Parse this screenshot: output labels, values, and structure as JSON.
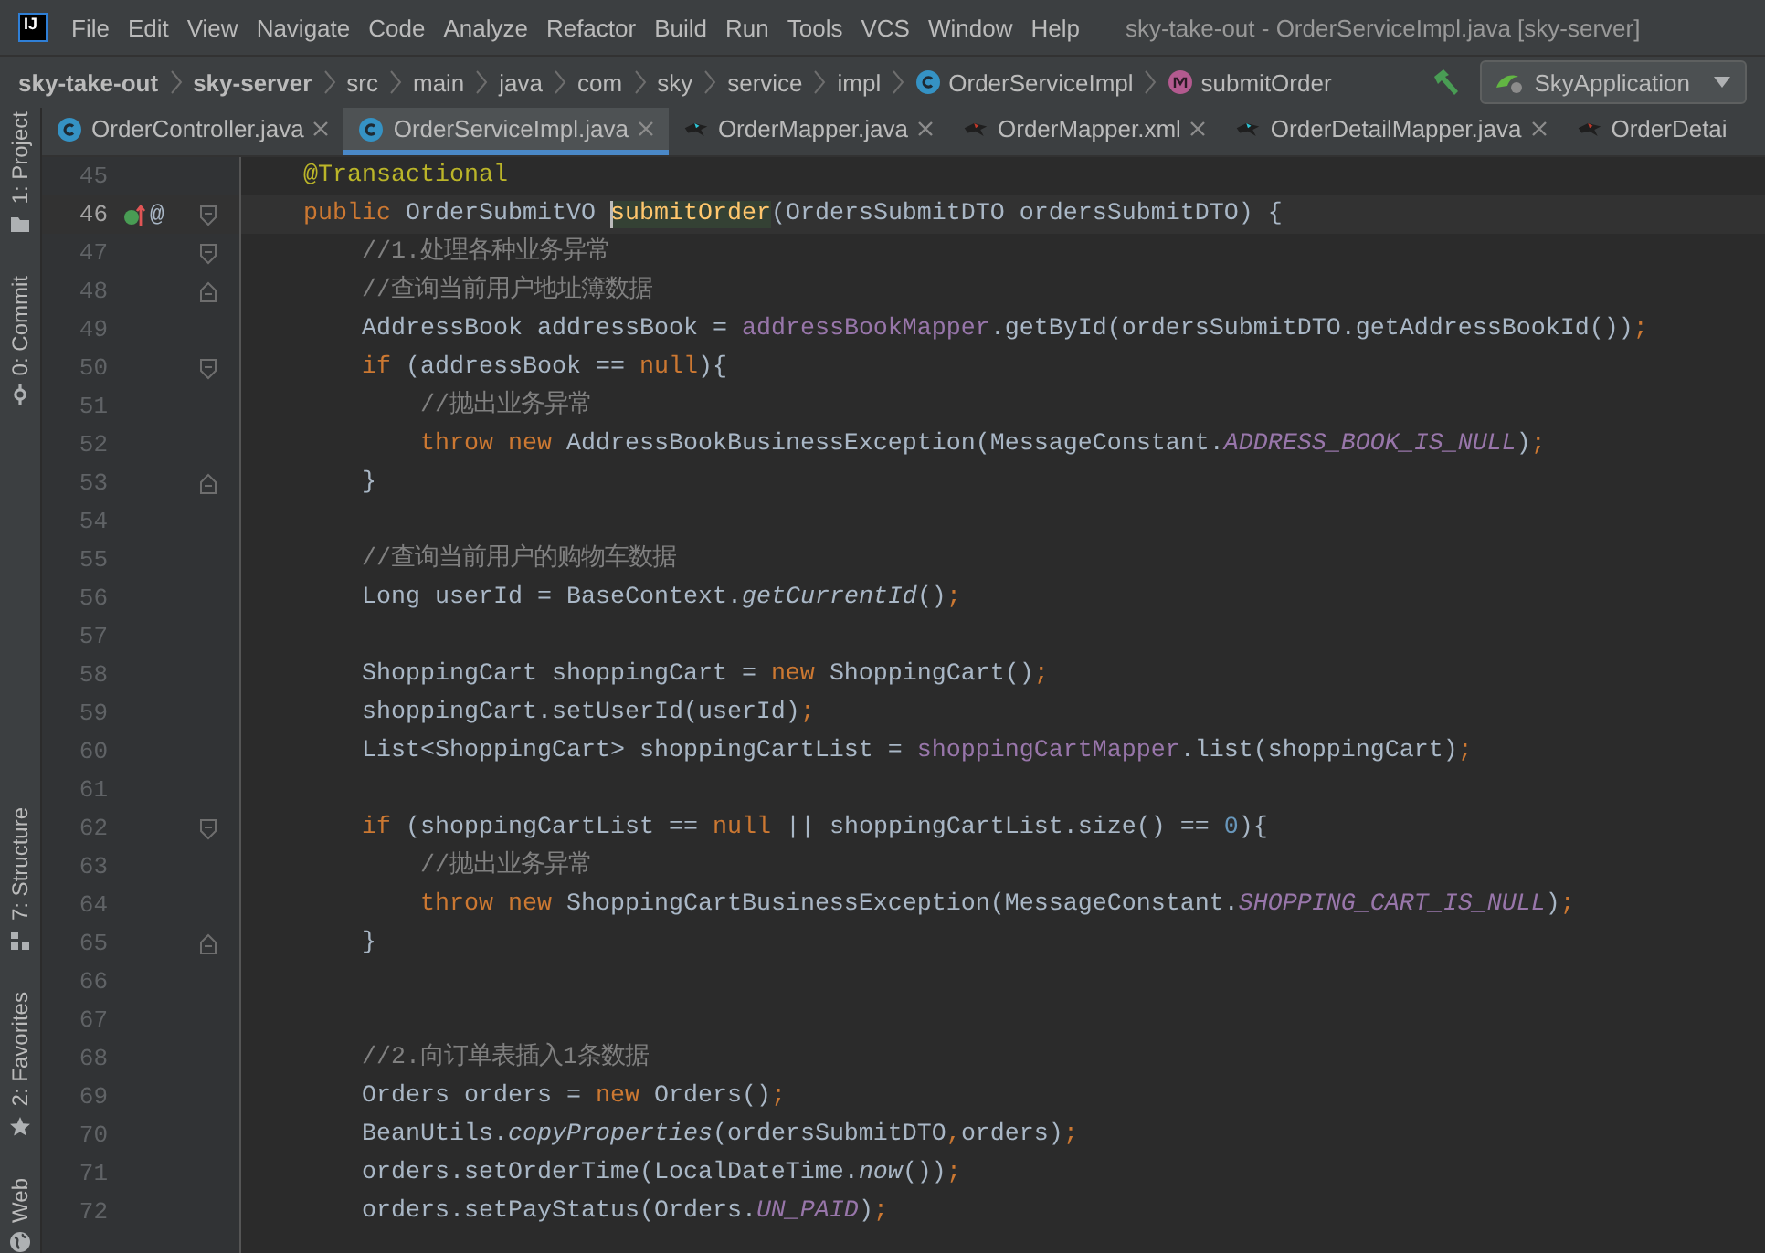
{
  "window": {
    "logo": "IJ",
    "title": "sky-take-out - OrderServiceImpl.java [sky-server]"
  },
  "menu": [
    "File",
    "Edit",
    "View",
    "Navigate",
    "Code",
    "Analyze",
    "Refactor",
    "Build",
    "Run",
    "Tools",
    "VCS",
    "Window",
    "Help"
  ],
  "breadcrumbs": [
    {
      "text": "sky-take-out",
      "kind": "module"
    },
    {
      "text": "sky-server",
      "kind": "module"
    },
    {
      "text": "src",
      "kind": "folder"
    },
    {
      "text": "main",
      "kind": "folder"
    },
    {
      "text": "java",
      "kind": "folder"
    },
    {
      "text": "com",
      "kind": "folder"
    },
    {
      "text": "sky",
      "kind": "folder"
    },
    {
      "text": "service",
      "kind": "folder"
    },
    {
      "text": "impl",
      "kind": "folder"
    },
    {
      "text": "OrderServiceImpl",
      "kind": "class"
    },
    {
      "text": "submitOrder",
      "kind": "method"
    }
  ],
  "run_config": {
    "name": "SkyApplication"
  },
  "tabs": [
    {
      "label": "OrderController.java",
      "kind": "class",
      "selected": false,
      "closable": true
    },
    {
      "label": "OrderServiceImpl.java",
      "kind": "class",
      "selected": true,
      "closable": true
    },
    {
      "label": "OrderMapper.java",
      "kind": "mapper",
      "selected": false,
      "closable": true
    },
    {
      "label": "OrderMapper.xml",
      "kind": "xml",
      "selected": false,
      "closable": true
    },
    {
      "label": "OrderDetailMapper.java",
      "kind": "mapper",
      "selected": false,
      "closable": true
    },
    {
      "label": "OrderDetai",
      "kind": "xml",
      "selected": false,
      "closable": false
    }
  ],
  "tool_windows": {
    "top": [
      {
        "label": "1: Project",
        "kind": "folder"
      },
      {
        "label": "0: Commit",
        "kind": "commit"
      }
    ],
    "bottom": [
      {
        "label": "7: Structure",
        "kind": "structure"
      },
      {
        "label": "2: Favorites",
        "kind": "star"
      },
      {
        "label": "Web",
        "kind": "globe"
      }
    ]
  },
  "editor": {
    "lines": [
      {
        "number": "45",
        "current": false,
        "tokens": [
          {
            "kind": "annotation",
            "text": "    @Transactional"
          }
        ]
      },
      {
        "number": "46",
        "current": true,
        "gutter": "@",
        "fold_open": true,
        "tokens": [
          {
            "kind": "keyword",
            "text": "    public "
          },
          {
            "kind": "plain",
            "text": "OrderSubmitVO "
          },
          {
            "kind": "declaration",
            "text": "submitOrder"
          },
          {
            "kind": "plain",
            "text": "(OrdersSubmitDTO ordersSubmitDTO) {"
          }
        ]
      },
      {
        "number": "47",
        "current": false,
        "fold_open": true,
        "tokens": [
          {
            "kind": "comment",
            "text": "        //1.处理各种业务异常"
          }
        ]
      },
      {
        "number": "48",
        "current": false,
        "fold_close": true,
        "tokens": [
          {
            "kind": "comment",
            "text": "        //查询当前用户地址簿数据"
          }
        ]
      },
      {
        "number": "49",
        "current": false,
        "tokens": [
          {
            "kind": "plain",
            "text": "        AddressBook addressBook = "
          },
          {
            "kind": "field",
            "text": "addressBookMapper"
          },
          {
            "kind": "plain",
            "text": ".getById(ordersSubmitDTO.getAddressBookId())"
          },
          {
            "kind": "keyword",
            "text": ";"
          }
        ]
      },
      {
        "number": "50",
        "current": false,
        "fold_open": true,
        "tokens": [
          {
            "kind": "keyword",
            "text": "        if "
          },
          {
            "kind": "plain",
            "text": "(addressBook == "
          },
          {
            "kind": "keyword",
            "text": "null"
          },
          {
            "kind": "plain",
            "text": "){"
          }
        ]
      },
      {
        "number": "51",
        "current": false,
        "tokens": [
          {
            "kind": "comment",
            "text": "            //抛出业务异常"
          }
        ]
      },
      {
        "number": "52",
        "current": false,
        "tokens": [
          {
            "kind": "keyword",
            "text": "            throw new "
          },
          {
            "kind": "plain",
            "text": "AddressBookBusinessException(MessageConstant."
          },
          {
            "kind": "constant",
            "text": "ADDRESS_BOOK_IS_NULL"
          },
          {
            "kind": "plain",
            "text": ")"
          },
          {
            "kind": "keyword",
            "text": ";"
          }
        ]
      },
      {
        "number": "53",
        "current": false,
        "fold_close": true,
        "tokens": [
          {
            "kind": "plain",
            "text": "        }"
          }
        ]
      },
      {
        "number": "54",
        "current": false
      },
      {
        "number": "55",
        "current": false,
        "tokens": [
          {
            "kind": "comment",
            "text": "        //查询当前用户的购物车数据"
          }
        ]
      },
      {
        "number": "56",
        "current": false,
        "tokens": [
          {
            "kind": "plain",
            "text": "        Long userId = BaseContext."
          },
          {
            "kind": "static",
            "text": "getCurrentId"
          },
          {
            "kind": "plain",
            "text": "()"
          },
          {
            "kind": "keyword",
            "text": ";"
          }
        ]
      },
      {
        "number": "57",
        "current": false
      },
      {
        "number": "58",
        "current": false,
        "tokens": [
          {
            "kind": "plain",
            "text": "        ShoppingCart shoppingCart = "
          },
          {
            "kind": "keyword",
            "text": "new "
          },
          {
            "kind": "plain",
            "text": "ShoppingCart()"
          },
          {
            "kind": "keyword",
            "text": ";"
          }
        ]
      },
      {
        "number": "59",
        "current": false,
        "tokens": [
          {
            "kind": "plain",
            "text": "        shoppingCart.setUserId(userId)"
          },
          {
            "kind": "keyword",
            "text": ";"
          }
        ]
      },
      {
        "number": "60",
        "current": false,
        "tokens": [
          {
            "kind": "plain",
            "text": "        List<ShoppingCart> shoppingCartList = "
          },
          {
            "kind": "field",
            "text": "shoppingCartMapper"
          },
          {
            "kind": "plain",
            "text": ".list(shoppingCart)"
          },
          {
            "kind": "keyword",
            "text": ";"
          }
        ]
      },
      {
        "number": "61",
        "current": false
      },
      {
        "number": "62",
        "current": false,
        "fold_open": true,
        "tokens": [
          {
            "kind": "keyword",
            "text": "        if "
          },
          {
            "kind": "plain",
            "text": "(shoppingCartList == "
          },
          {
            "kind": "keyword",
            "text": "null "
          },
          {
            "kind": "plain",
            "text": "|| shoppingCartList.size() == "
          },
          {
            "kind": "number",
            "text": "0"
          },
          {
            "kind": "plain",
            "text": "){"
          }
        ]
      },
      {
        "number": "63",
        "current": false,
        "tokens": [
          {
            "kind": "comment",
            "text": "            //抛出业务异常"
          }
        ]
      },
      {
        "number": "64",
        "current": false,
        "tokens": [
          {
            "kind": "keyword",
            "text": "            throw new "
          },
          {
            "kind": "plain",
            "text": "ShoppingCartBusinessException(MessageConstant."
          },
          {
            "kind": "constant",
            "text": "SHOPPING_CART_IS_NULL"
          },
          {
            "kind": "plain",
            "text": ")"
          },
          {
            "kind": "keyword",
            "text": ";"
          }
        ]
      },
      {
        "number": "65",
        "current": false,
        "fold_close": true,
        "tokens": [
          {
            "kind": "plain",
            "text": "        }"
          }
        ]
      },
      {
        "number": "66",
        "current": false
      },
      {
        "number": "67",
        "current": false
      },
      {
        "number": "68",
        "current": false,
        "tokens": [
          {
            "kind": "comment",
            "text": "        //2.向订单表插入1条数据"
          }
        ]
      },
      {
        "number": "69",
        "current": false,
        "tokens": [
          {
            "kind": "plain",
            "text": "        Orders orders = "
          },
          {
            "kind": "keyword",
            "text": "new "
          },
          {
            "kind": "plain",
            "text": "Orders()"
          },
          {
            "kind": "keyword",
            "text": ";"
          }
        ]
      },
      {
        "number": "70",
        "current": false,
        "tokens": [
          {
            "kind": "plain",
            "text": "        BeanUtils."
          },
          {
            "kind": "static",
            "text": "copyProperties"
          },
          {
            "kind": "plain",
            "text": "(ordersSubmitDTO"
          },
          {
            "kind": "keyword",
            "text": ","
          },
          {
            "kind": "plain",
            "text": "orders)"
          },
          {
            "kind": "keyword",
            "text": ";"
          }
        ]
      },
      {
        "number": "71",
        "current": false,
        "tokens": [
          {
            "kind": "plain",
            "text": "        orders.setOrderTime(LocalDateTime."
          },
          {
            "kind": "static",
            "text": "now"
          },
          {
            "kind": "plain",
            "text": "())"
          },
          {
            "kind": "keyword",
            "text": ";"
          }
        ]
      },
      {
        "number": "72",
        "current": false,
        "tokens": [
          {
            "kind": "plain",
            "text": "        orders.setPayStatus(Orders."
          },
          {
            "kind": "constant",
            "text": "UN_PAID"
          },
          {
            "kind": "plain",
            "text": ")"
          },
          {
            "kind": "keyword",
            "text": ";"
          }
        ]
      }
    ]
  }
}
